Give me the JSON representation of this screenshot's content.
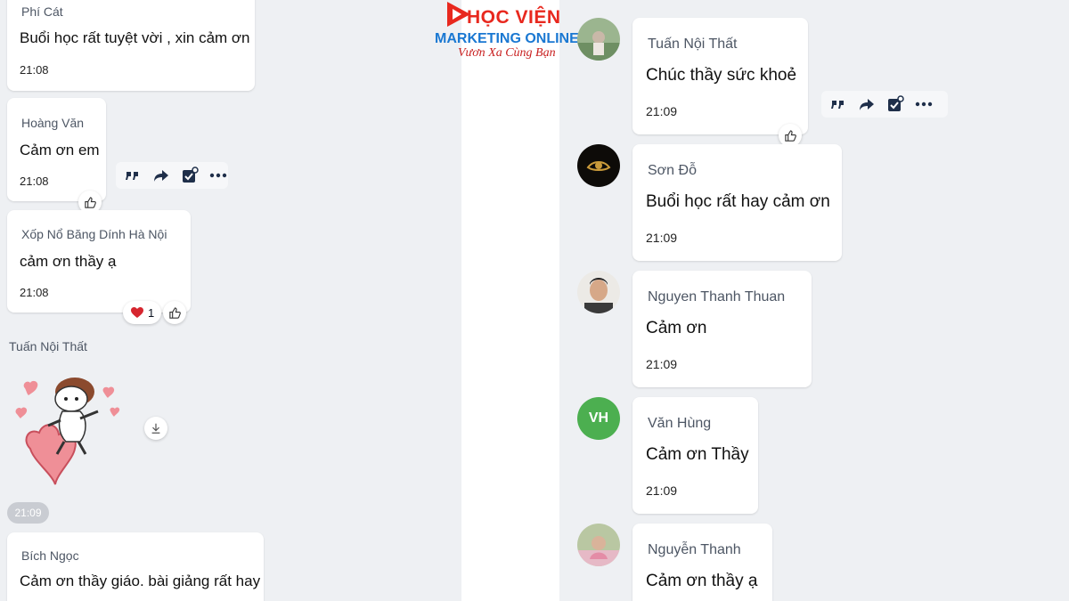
{
  "logo": {
    "line1": "HỌC VIỆN",
    "line2": "MARKETING ONLINE",
    "tagline": "Vươn Xa Cùng Bạn",
    "brand_colors": {
      "red": "#e8281e",
      "blue": "#1a78d2"
    }
  },
  "left_messages": [
    {
      "sender": "Phí Cát",
      "text": "Buổi học rất tuyệt vời , xin cảm ơn",
      "time": "21:08"
    },
    {
      "sender": "Hoàng Văn",
      "text": "Cảm ơn em",
      "time": "21:08"
    },
    {
      "sender": "Xốp Nổ Băng Dính Hà Nội",
      "text": "cảm ơn thầy ạ",
      "time": "21:08",
      "reaction_count": "1"
    }
  ],
  "sticker_message": {
    "sender": "Tuấn Nội Thất",
    "time": "21:09"
  },
  "last_left_message": {
    "sender": "Bích Ngọc",
    "text": "Cảm ơn thầy giáo. bài giảng rất hay"
  },
  "right_messages": [
    {
      "sender": "Tuấn Nội Thất",
      "text": "Chúc thầy sức khoẻ",
      "time": "21:09"
    },
    {
      "sender": "Sơn Đỗ",
      "text": "Buổi học rất hay cảm ơn",
      "time": "21:09"
    },
    {
      "sender": "Nguyen Thanh Thuan",
      "text": "Cảm ơn",
      "time": "21:09"
    },
    {
      "sender": "Văn Hùng",
      "text": "Cảm ơn Thầy",
      "time": "21:09",
      "avatar_initials": "VH"
    },
    {
      "sender": "Nguyễn Thanh",
      "text": "Cảm  ơn thầy ạ"
    }
  ],
  "icons": [
    "quote-icon",
    "forward-icon",
    "task-icon",
    "more-icon",
    "like-icon",
    "heart-icon",
    "download-icon"
  ]
}
